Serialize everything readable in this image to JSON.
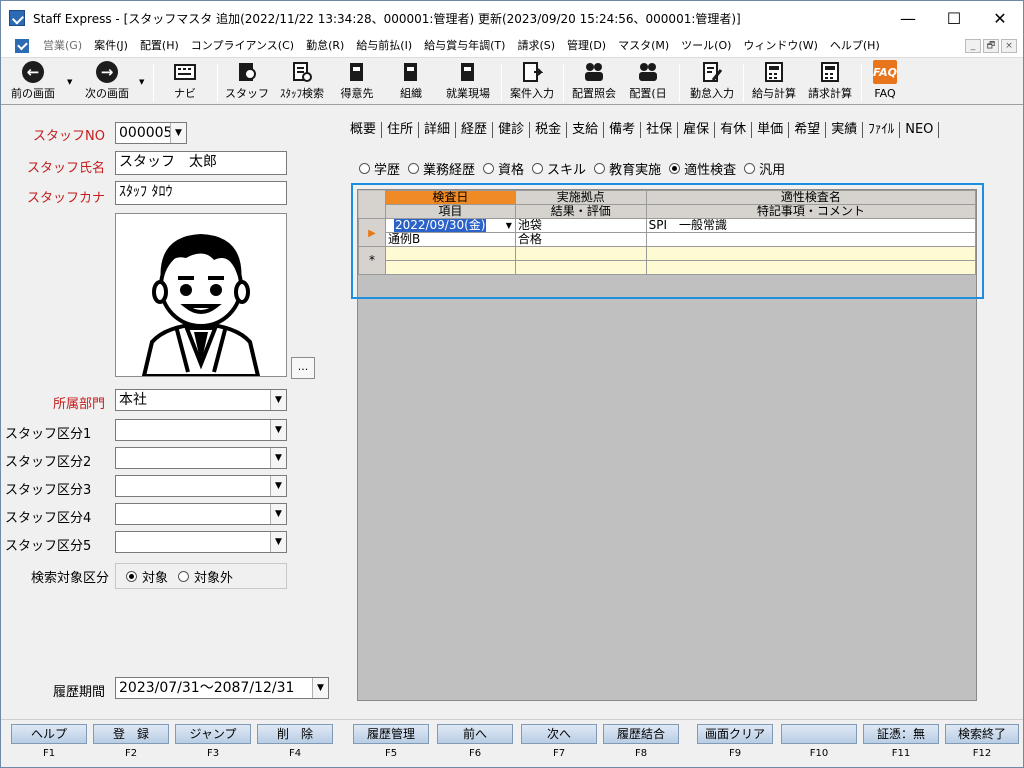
{
  "window": {
    "title": "Staff Express - [スタッフマスタ 追加(2022/11/22 13:34:28、000001:管理者) 更新(2023/09/20 15:24:56、000001:管理者)]",
    "min": "—",
    "max": "☐",
    "close": "✕"
  },
  "menu": [
    "営業(G)",
    "案件(J)",
    "配置(H)",
    "コンプライアンス(C)",
    "勤怠(R)",
    "給与前払(I)",
    "給与賞与年調(T)",
    "請求(S)",
    "管理(D)",
    "マスタ(M)",
    "ツール(O)",
    "ウィンドウ(W)",
    "ヘルプ(H)"
  ],
  "mdi": [
    "_",
    "🗗",
    "×"
  ],
  "toolbar": {
    "prev": "前の画面",
    "next": "次の画面",
    "navi": "ナビ",
    "staff": "スタッフ",
    "staff_search": "ｽﾀｯﾌ検索",
    "customer": "得意先",
    "org": "組織",
    "site": "就業現場",
    "project": "案件入力",
    "assign_inq": "配置照会",
    "assign_day": "配置(日",
    "attendance": "勤怠入力",
    "payroll": "給与計算",
    "billing": "請求計算",
    "faq": "FAQ"
  },
  "form": {
    "staff_no_label": "スタッフNO",
    "staff_no": "000005",
    "staff_name_label": "スタッフ氏名",
    "staff_name": "スタッフ　太郎",
    "staff_kana_label": "スタッフカナ",
    "staff_kana": "ｽﾀｯﾌ ﾀﾛｳ",
    "photo_btn": "...",
    "dept_label": "所属部門",
    "dept": "本社",
    "class1_label": "スタッフ区分1",
    "class2_label": "スタッフ区分2",
    "class3_label": "スタッフ区分3",
    "class4_label": "スタッフ区分4",
    "class5_label": "スタッフ区分5",
    "search_label": "検索対象区分",
    "search_on": "対象",
    "search_off": "対象外",
    "period_label": "履歴期間",
    "period": "2023/07/31～2087/12/31"
  },
  "tabs": [
    "概要",
    "住所",
    "詳細",
    "経歴",
    "健診",
    "税金",
    "支給",
    "備考",
    "社保",
    "雇保",
    "有休",
    "単価",
    "希望",
    "実績",
    "ﾌｧｲﾙ",
    "NEO"
  ],
  "history_types": [
    "学歴",
    "業務経歴",
    "資格",
    "スキル",
    "教育実施",
    "適性検査",
    "汎用"
  ],
  "grid": {
    "headers1": [
      "検査日",
      "実施拠点",
      "適性検査名"
    ],
    "headers2": [
      "項目",
      "結果・評価",
      "特記事項・コメント"
    ],
    "row1": [
      "2022/09/30(金)",
      "池袋",
      "SPI　一般常識"
    ],
    "row2": [
      "通例B",
      "合格",
      ""
    ],
    "new_marker": "*"
  },
  "fkeys": [
    {
      "label": "ヘルプ",
      "key": "F1"
    },
    {
      "label": "登　録",
      "key": "F2"
    },
    {
      "label": "ジャンプ",
      "key": "F3"
    },
    {
      "label": "削　除",
      "key": "F4"
    },
    {
      "label": "履歴管理",
      "key": "F5"
    },
    {
      "label": "前へ",
      "key": "F6"
    },
    {
      "label": "次へ",
      "key": "F7"
    },
    {
      "label": "履歴結合",
      "key": "F8"
    },
    {
      "label": "画面クリア",
      "key": "F9"
    },
    {
      "label": "",
      "key": "F10"
    },
    {
      "label": "証憑：無",
      "key": "F11"
    },
    {
      "label": "検索終了",
      "key": "F12"
    }
  ],
  "colors": {
    "accent": "#1e8fe0",
    "header_sel": "#f08a24",
    "label_red": "#c51d1d"
  }
}
